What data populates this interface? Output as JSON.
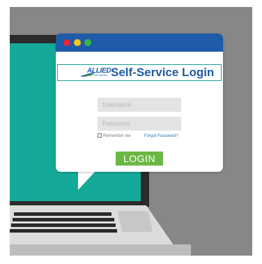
{
  "window": {
    "title": "Self-Service Login",
    "controls": [
      "close-dot",
      "minimize-dot",
      "maximize-dot"
    ]
  },
  "brand": {
    "logo_text": "ALLIED",
    "logo_subtext": "NETWORK",
    "accent_color": "#1e5ba8",
    "border_color": "#18a090"
  },
  "form": {
    "username_placeholder": "Username",
    "password_placeholder": "Password",
    "remember_label": "Remember me",
    "forgot_label": "Forgot Password?",
    "login_label": "LOGIN",
    "login_color": "#6bb744"
  },
  "scene": {
    "background_color": "#878787",
    "screen_color": "#15a99a"
  }
}
